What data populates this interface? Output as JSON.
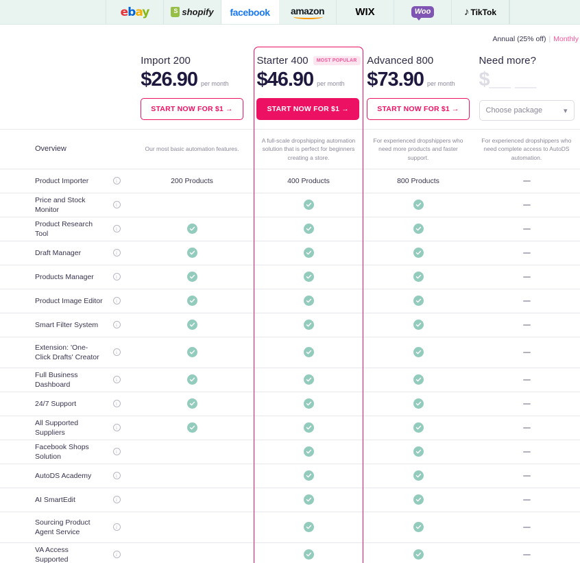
{
  "platforms": [
    {
      "name": "ebay",
      "label": "ebay",
      "active": false
    },
    {
      "name": "shopify",
      "label": "shopify",
      "active": false
    },
    {
      "name": "facebook",
      "label": "facebook",
      "active": true
    },
    {
      "name": "amazon",
      "label": "amazon",
      "active": false
    },
    {
      "name": "wix",
      "label": "WIX",
      "active": false
    },
    {
      "name": "woocommerce",
      "label": "Woo",
      "active": false
    },
    {
      "name": "tiktok",
      "label": "TikTok",
      "active": false
    }
  ],
  "billing": {
    "annual": "Annual (25% off)",
    "separator": "|",
    "monthly": "Monthly",
    "selected": "Monthly"
  },
  "plans": [
    {
      "title": "Import 200",
      "badge": null,
      "price": "$26.90",
      "per": "per month",
      "cta": "START NOW FOR $1  →",
      "cta_style": "outline",
      "overview": "Our most basic automation features."
    },
    {
      "title": "Starter 400",
      "badge": "MOST POPULAR",
      "price": "$46.90",
      "per": "per month",
      "cta": "START NOW FOR $1  →",
      "cta_style": "filled",
      "overview": "A full-scale dropshipping automation solution that is perfect for beginners creating a store."
    },
    {
      "title": "Advanced 800",
      "badge": null,
      "price": "$73.90",
      "per": "per month",
      "cta": "START NOW FOR $1  →",
      "cta_style": "outline",
      "overview": "For experienced dropshippers who need more products and faster support."
    },
    {
      "title": "Need more?",
      "badge": null,
      "price": "$__ __",
      "per": "",
      "cta": null,
      "select_placeholder": "Choose package",
      "overview": "For experienced dropshippers who need complete access to AutoDS automation."
    }
  ],
  "overview_label": "Overview",
  "features": [
    {
      "label": "Product Importer",
      "values": [
        "200 Products",
        "400 Products",
        "800 Products",
        "dash"
      ]
    },
    {
      "label": "Price and Stock Monitor",
      "values": [
        "blank",
        "check",
        "check",
        "dash"
      ]
    },
    {
      "label": "Product Research Tool",
      "values": [
        "check",
        "check",
        "check",
        "dash"
      ]
    },
    {
      "label": "Draft Manager",
      "values": [
        "check",
        "check",
        "check",
        "dash"
      ]
    },
    {
      "label": "Products Manager",
      "values": [
        "check",
        "check",
        "check",
        "dash"
      ]
    },
    {
      "label": "Product Image Editor",
      "values": [
        "check",
        "check",
        "check",
        "dash"
      ]
    },
    {
      "label": "Smart Filter System",
      "values": [
        "check",
        "check",
        "check",
        "dash"
      ]
    },
    {
      "label": "Extension: 'One-Click Drafts' Creator",
      "values": [
        "check",
        "check",
        "check",
        "dash"
      ],
      "tall": true
    },
    {
      "label": "Full Business Dashboard",
      "values": [
        "check",
        "check",
        "check",
        "dash"
      ]
    },
    {
      "label": "24/7 Support",
      "values": [
        "check",
        "check",
        "check",
        "dash"
      ]
    },
    {
      "label": "All Supported Suppliers",
      "values": [
        "check",
        "check",
        "check",
        "dash"
      ]
    },
    {
      "label": "Facebook Shops Solution",
      "values": [
        "blank",
        "check",
        "check",
        "dash"
      ]
    },
    {
      "label": "AutoDS Academy",
      "values": [
        "blank",
        "check",
        "check",
        "dash"
      ]
    },
    {
      "label": "AI SmartEdit",
      "values": [
        "blank",
        "check",
        "check",
        "dash"
      ]
    },
    {
      "label": "Sourcing Product Agent Service",
      "values": [
        "blank",
        "check",
        "check",
        "dash"
      ],
      "tall": true
    },
    {
      "label": "VA Access Supported",
      "values": [
        "blank",
        "check",
        "check",
        "dash"
      ]
    }
  ],
  "icons": {
    "info": "i",
    "chevron_down": "⌄",
    "check": "check-icon",
    "dash": "minus-icon"
  },
  "colors": {
    "accent_pink": "#ec1163",
    "badge_pink_bg": "#fde5ef",
    "check_green": "#93ccbd",
    "header_mint": "#e9f3f0",
    "text_dark": "#2d2a45",
    "text_muted": "#8b8799"
  }
}
